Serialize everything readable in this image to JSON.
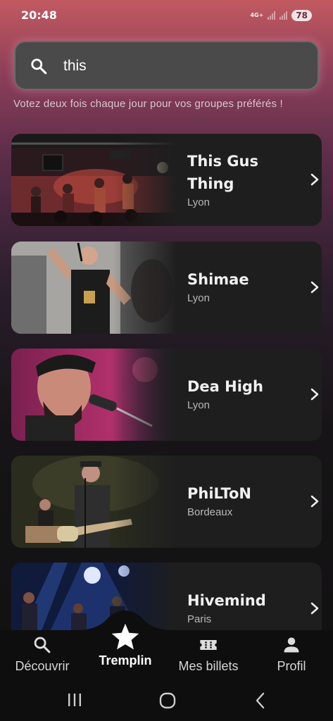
{
  "status": {
    "time": "20:48",
    "network": "4G+",
    "battery": "78"
  },
  "search": {
    "value": "this",
    "placeholder": ""
  },
  "tagline": "Votez deux fois chaque jour pour vos groupes préférés !",
  "bands": [
    {
      "name": "This Gus Thing",
      "city": "Lyon"
    },
    {
      "name": "Shimae",
      "city": "Lyon"
    },
    {
      "name": "Dea High",
      "city": "Lyon"
    },
    {
      "name": "PhiLToN",
      "city": "Bordeaux"
    },
    {
      "name": "Hivemind",
      "city": "Paris"
    }
  ],
  "nav": {
    "discover": "Découvrir",
    "tremplin": "Tremplin",
    "tickets": "Mes billets",
    "profile": "Profil"
  },
  "icons": [
    "search-icon",
    "chevron-right-icon",
    "star-icon",
    "ticket-icon",
    "person-icon"
  ],
  "colors": {
    "accent_gradient_top": "#c25a60",
    "card_bg": "#1e1e1e",
    "nav_bg": "#0e0e0e"
  }
}
